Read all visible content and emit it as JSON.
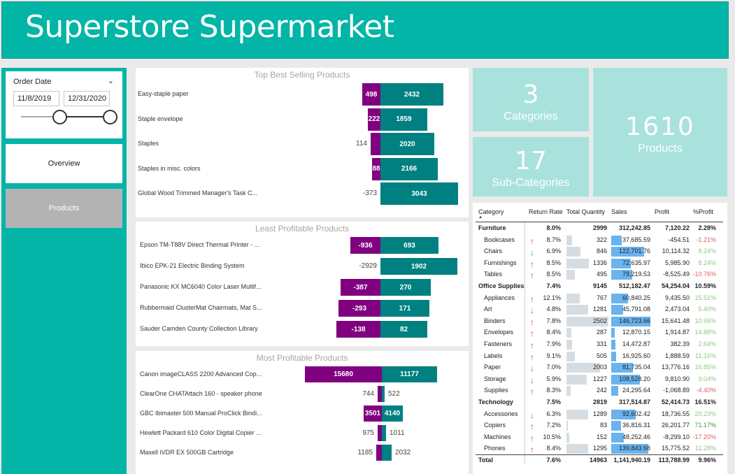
{
  "app_title": "Superstore Supermarket",
  "slicer": {
    "label": "Order Date",
    "start": "11/8/2019",
    "end": "12/31/2020"
  },
  "nav": {
    "overview": "Overview",
    "products": "Products"
  },
  "best_selling": {
    "title": "Top Best Selling Products",
    "rows": [
      {
        "name": "Easy-staple paper",
        "neg": "498",
        "pos": "2432"
      },
      {
        "name": "Staple envelope",
        "neg": "222",
        "pos": "1859"
      },
      {
        "name": "Staples",
        "neg": "114",
        "pos": "2020"
      },
      {
        "name": "Staples in misc. colors",
        "neg": "88",
        "pos": "2166"
      },
      {
        "name": "Global Wood Trimmed Manager's Task C...",
        "neg": "-373",
        "pos": "3043"
      }
    ]
  },
  "least_profitable": {
    "title": "Least Profitable Products",
    "rows": [
      {
        "name": "Epson TM-T88V Direct Thermal Printer - ...",
        "neg": "-936",
        "pos": "693"
      },
      {
        "name": "Ibico EPK-21 Electric Binding System",
        "neg": "-2929",
        "pos": "1902"
      },
      {
        "name": "Panasonic KX MC6040 Color Laser Multif...",
        "neg": "-387",
        "pos": "270"
      },
      {
        "name": "Rubbermaid ClusterMat Chairmats, Mat S...",
        "neg": "-293",
        "pos": "171"
      },
      {
        "name": "Sauder Camden County Collection Library",
        "neg": "-138",
        "pos": "82"
      }
    ]
  },
  "most_profitable": {
    "title": "Most Profitable Products",
    "rows": [
      {
        "name": "Canon imageCLASS 2200 Advanced Cop...",
        "neg": "15680",
        "pos": "11177"
      },
      {
        "name": "ClearOne CHATAttach 160 - speaker phone",
        "neg": "744",
        "pos": "522"
      },
      {
        "name": "GBC Ibimaster 500 Manual ProClick Bindi...",
        "neg": "3501",
        "pos": "4140"
      },
      {
        "name": "Hewlett Packard 610 Color Digital Copier ...",
        "neg": "975",
        "pos": "1011"
      },
      {
        "name": "Maxell iVDR EX 500GB Cartridge",
        "neg": "1185",
        "pos": "2032"
      }
    ]
  },
  "kpis": {
    "categories": {
      "value": "3",
      "label": "Categories"
    },
    "subcategories": {
      "value": "17",
      "label": "Sub-Categories"
    },
    "products": {
      "value": "1610",
      "label": "Products"
    }
  },
  "matrix": {
    "headers": [
      "Category",
      "Return Rate",
      "Total Quantity",
      "Sales",
      "Profit",
      "%Profit"
    ],
    "colors": {
      "up": "#e0362c",
      "down": "#3a9a3a",
      "pos_pct": "#8dc97f",
      "neg_pct": "#e06060"
    },
    "rows": [
      {
        "type": "cat",
        "name": "Furniture",
        "rate": "8.0%",
        "qty": "2999",
        "sales": "312,242.85",
        "profit": "7,120.22",
        "pct": "2.28%"
      },
      {
        "type": "sub",
        "name": "Bookcases",
        "arrow": "up",
        "rate": "8.7%",
        "qty": "322",
        "qty_frac": 0.13,
        "sales": "37,685.59",
        "sales_frac": 0.26,
        "profit": "-454.51",
        "pct": "-1.21%",
        "pct_color": "neg"
      },
      {
        "type": "sub",
        "name": "Chairs",
        "arrow": "down",
        "rate": "6.9%",
        "qty": "846",
        "qty_frac": 0.34,
        "sales": "122,701.76",
        "sales_frac": 0.84,
        "profit": "10,114.32",
        "pct": "8.24%",
        "pct_color": "pos"
      },
      {
        "type": "sub",
        "name": "Furnishings",
        "arrow": "up",
        "rate": "8.5%",
        "qty": "1336",
        "qty_frac": 0.53,
        "sales": "72,635.97",
        "sales_frac": 0.5,
        "profit": "5,985.90",
        "pct": "8.24%",
        "pct_color": "pos"
      },
      {
        "type": "sub",
        "name": "Tables",
        "arrow": "up",
        "rate": "8.5%",
        "qty": "495",
        "qty_frac": 0.2,
        "sales": "79,219.53",
        "sales_frac": 0.54,
        "profit": "-8,525.49",
        "pct": "-10.76%",
        "pct_color": "neg"
      },
      {
        "type": "cat",
        "name": "Office Supplies",
        "rate": "7.4%",
        "qty": "9145",
        "sales": "512,182.47",
        "profit": "54,254.04",
        "pct": "10.59%"
      },
      {
        "type": "sub",
        "name": "Appliances",
        "arrow": "up",
        "rate": "12.1%",
        "qty": "767",
        "qty_frac": 0.31,
        "sales": "60,840.25",
        "sales_frac": 0.42,
        "profit": "9,435.50",
        "pct": "15.51%",
        "pct_color": "pos"
      },
      {
        "type": "sub",
        "name": "Art",
        "arrow": "down",
        "rate": "4.8%",
        "qty": "1281",
        "qty_frac": 0.51,
        "sales": "45,791.08",
        "sales_frac": 0.31,
        "profit": "2,473.04",
        "pct": "5.40%",
        "pct_color": "pos"
      },
      {
        "type": "sub",
        "name": "Binders",
        "arrow": "up",
        "rate": "7.8%",
        "qty": "2502",
        "qty_frac": 1.0,
        "sales": "146,723.66",
        "sales_frac": 1.0,
        "profit": "15,641.48",
        "pct": "10.66%",
        "pct_color": "pos"
      },
      {
        "type": "sub",
        "name": "Envelopes",
        "arrow": "up",
        "rate": "8.4%",
        "qty": "287",
        "qty_frac": 0.11,
        "sales": "12,870.15",
        "sales_frac": 0.09,
        "profit": "1,914.87",
        "pct": "14.88%",
        "pct_color": "pos"
      },
      {
        "type": "sub",
        "name": "Fasteners",
        "arrow": "up",
        "rate": "7.9%",
        "qty": "331",
        "qty_frac": 0.13,
        "sales": "14,472.87",
        "sales_frac": 0.1,
        "profit": "382.39",
        "pct": "2.64%",
        "pct_color": "pos"
      },
      {
        "type": "sub",
        "name": "Labels",
        "arrow": "up",
        "rate": "9.1%",
        "qty": "505",
        "qty_frac": 0.2,
        "sales": "16,925.60",
        "sales_frac": 0.12,
        "profit": "1,888.59",
        "pct": "11.16%",
        "pct_color": "pos"
      },
      {
        "type": "sub",
        "name": "Paper",
        "arrow": "down",
        "rate": "7.0%",
        "qty": "2003",
        "qty_frac": 0.8,
        "sales": "81,735.04",
        "sales_frac": 0.56,
        "profit": "13,776.16",
        "pct": "16.85%",
        "pct_color": "pos"
      },
      {
        "type": "sub",
        "name": "Storage",
        "arrow": "down",
        "rate": "5.9%",
        "qty": "1227",
        "qty_frac": 0.49,
        "sales": "108,528.20",
        "sales_frac": 0.74,
        "profit": "9,810.90",
        "pct": "9.04%",
        "pct_color": "pos"
      },
      {
        "type": "sub",
        "name": "Supplies",
        "arrow": "up",
        "rate": "8.3%",
        "qty": "242",
        "qty_frac": 0.1,
        "sales": "24,295.64",
        "sales_frac": 0.17,
        "profit": "-1,068.89",
        "pct": "-4.40%",
        "pct_color": "neg"
      },
      {
        "type": "cat",
        "name": "Technology",
        "rate": "7.5%",
        "qty": "2819",
        "sales": "317,514.87",
        "profit": "52,414.73",
        "pct": "16.51%"
      },
      {
        "type": "sub",
        "name": "Accessories",
        "arrow": "down",
        "rate": "6.3%",
        "qty": "1289",
        "qty_frac": 0.52,
        "sales": "92,602.42",
        "sales_frac": 0.63,
        "profit": "18,736.55",
        "pct": "20.23%",
        "pct_color": "pos"
      },
      {
        "type": "sub",
        "name": "Copiers",
        "arrow": "up",
        "rate": "7.2%",
        "qty": "83",
        "qty_frac": 0.03,
        "sales": "36,816.31",
        "sales_frac": 0.25,
        "profit": "26,201.77",
        "pct": "71.17%",
        "pct_color": "pos"
      },
      {
        "type": "sub",
        "name": "Machines",
        "arrow": "up",
        "rate": "10.5%",
        "qty": "152",
        "qty_frac": 0.06,
        "sales": "48,252.46",
        "sales_frac": 0.33,
        "profit": "-8,299.10",
        "pct": "-17.20%",
        "pct_color": "neg"
      },
      {
        "type": "sub",
        "name": "Phones",
        "arrow": "up",
        "rate": "8.4%",
        "qty": "1295",
        "qty_frac": 0.52,
        "sales": "139,843.68",
        "sales_frac": 0.95,
        "profit": "15,775.52",
        "pct": "11.28%",
        "pct_color": "pos"
      },
      {
        "type": "total",
        "name": "Total",
        "rate": "7.6%",
        "qty": "14963",
        "sales": "1,141,940.19",
        "profit": "113,788.99",
        "pct": "9.96%"
      }
    ]
  }
}
